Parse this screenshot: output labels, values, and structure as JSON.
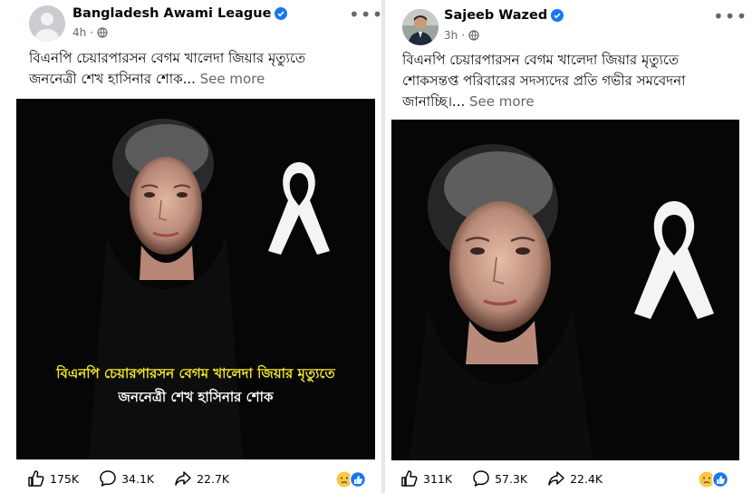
{
  "left_post": {
    "author": "Bangladesh Awami League",
    "time": "4h",
    "caption_line1": "বিএনপি চেয়ারপারসন বেগম খালেদা জিয়ার মৃত্যুতে",
    "caption_line2": "জননেত্রী শেখ হাসিনার শোক...",
    "see_more": "See more",
    "overlay_line1": "বিএনপি চেয়ারপারসন বেগম খালেদা জিয়ার মৃত্যুতে",
    "overlay_line2": "জননেত্রী শেখ হাসিনার শোক",
    "likes": "175K",
    "comments": "34.1K",
    "shares": "22.7K"
  },
  "right_post": {
    "author": "Sajeeb Wazed",
    "time": "3h",
    "caption_line1": "বিএনপি চেয়ারপারসন বেগম খালেদা জিয়ার মৃত্যুতে",
    "caption_line2": "শোকসন্তপ্ত পরিবারের সদস্যদের প্রতি গভীর সমবেদনা",
    "caption_line3": "জানাচ্ছি।...",
    "see_more": "See more",
    "likes": "311K",
    "comments": "57.3K",
    "shares": "22.4K"
  },
  "icons": {
    "more": "more-options-icon",
    "globe": "globe-icon",
    "verified": "verified-badge-icon",
    "like": "like-icon",
    "comment": "comment-icon",
    "share": "share-icon"
  },
  "colors": {
    "verified": "#1877f2",
    "overlay_yellow": "#f2e626",
    "secondary_text": "#65676b"
  }
}
